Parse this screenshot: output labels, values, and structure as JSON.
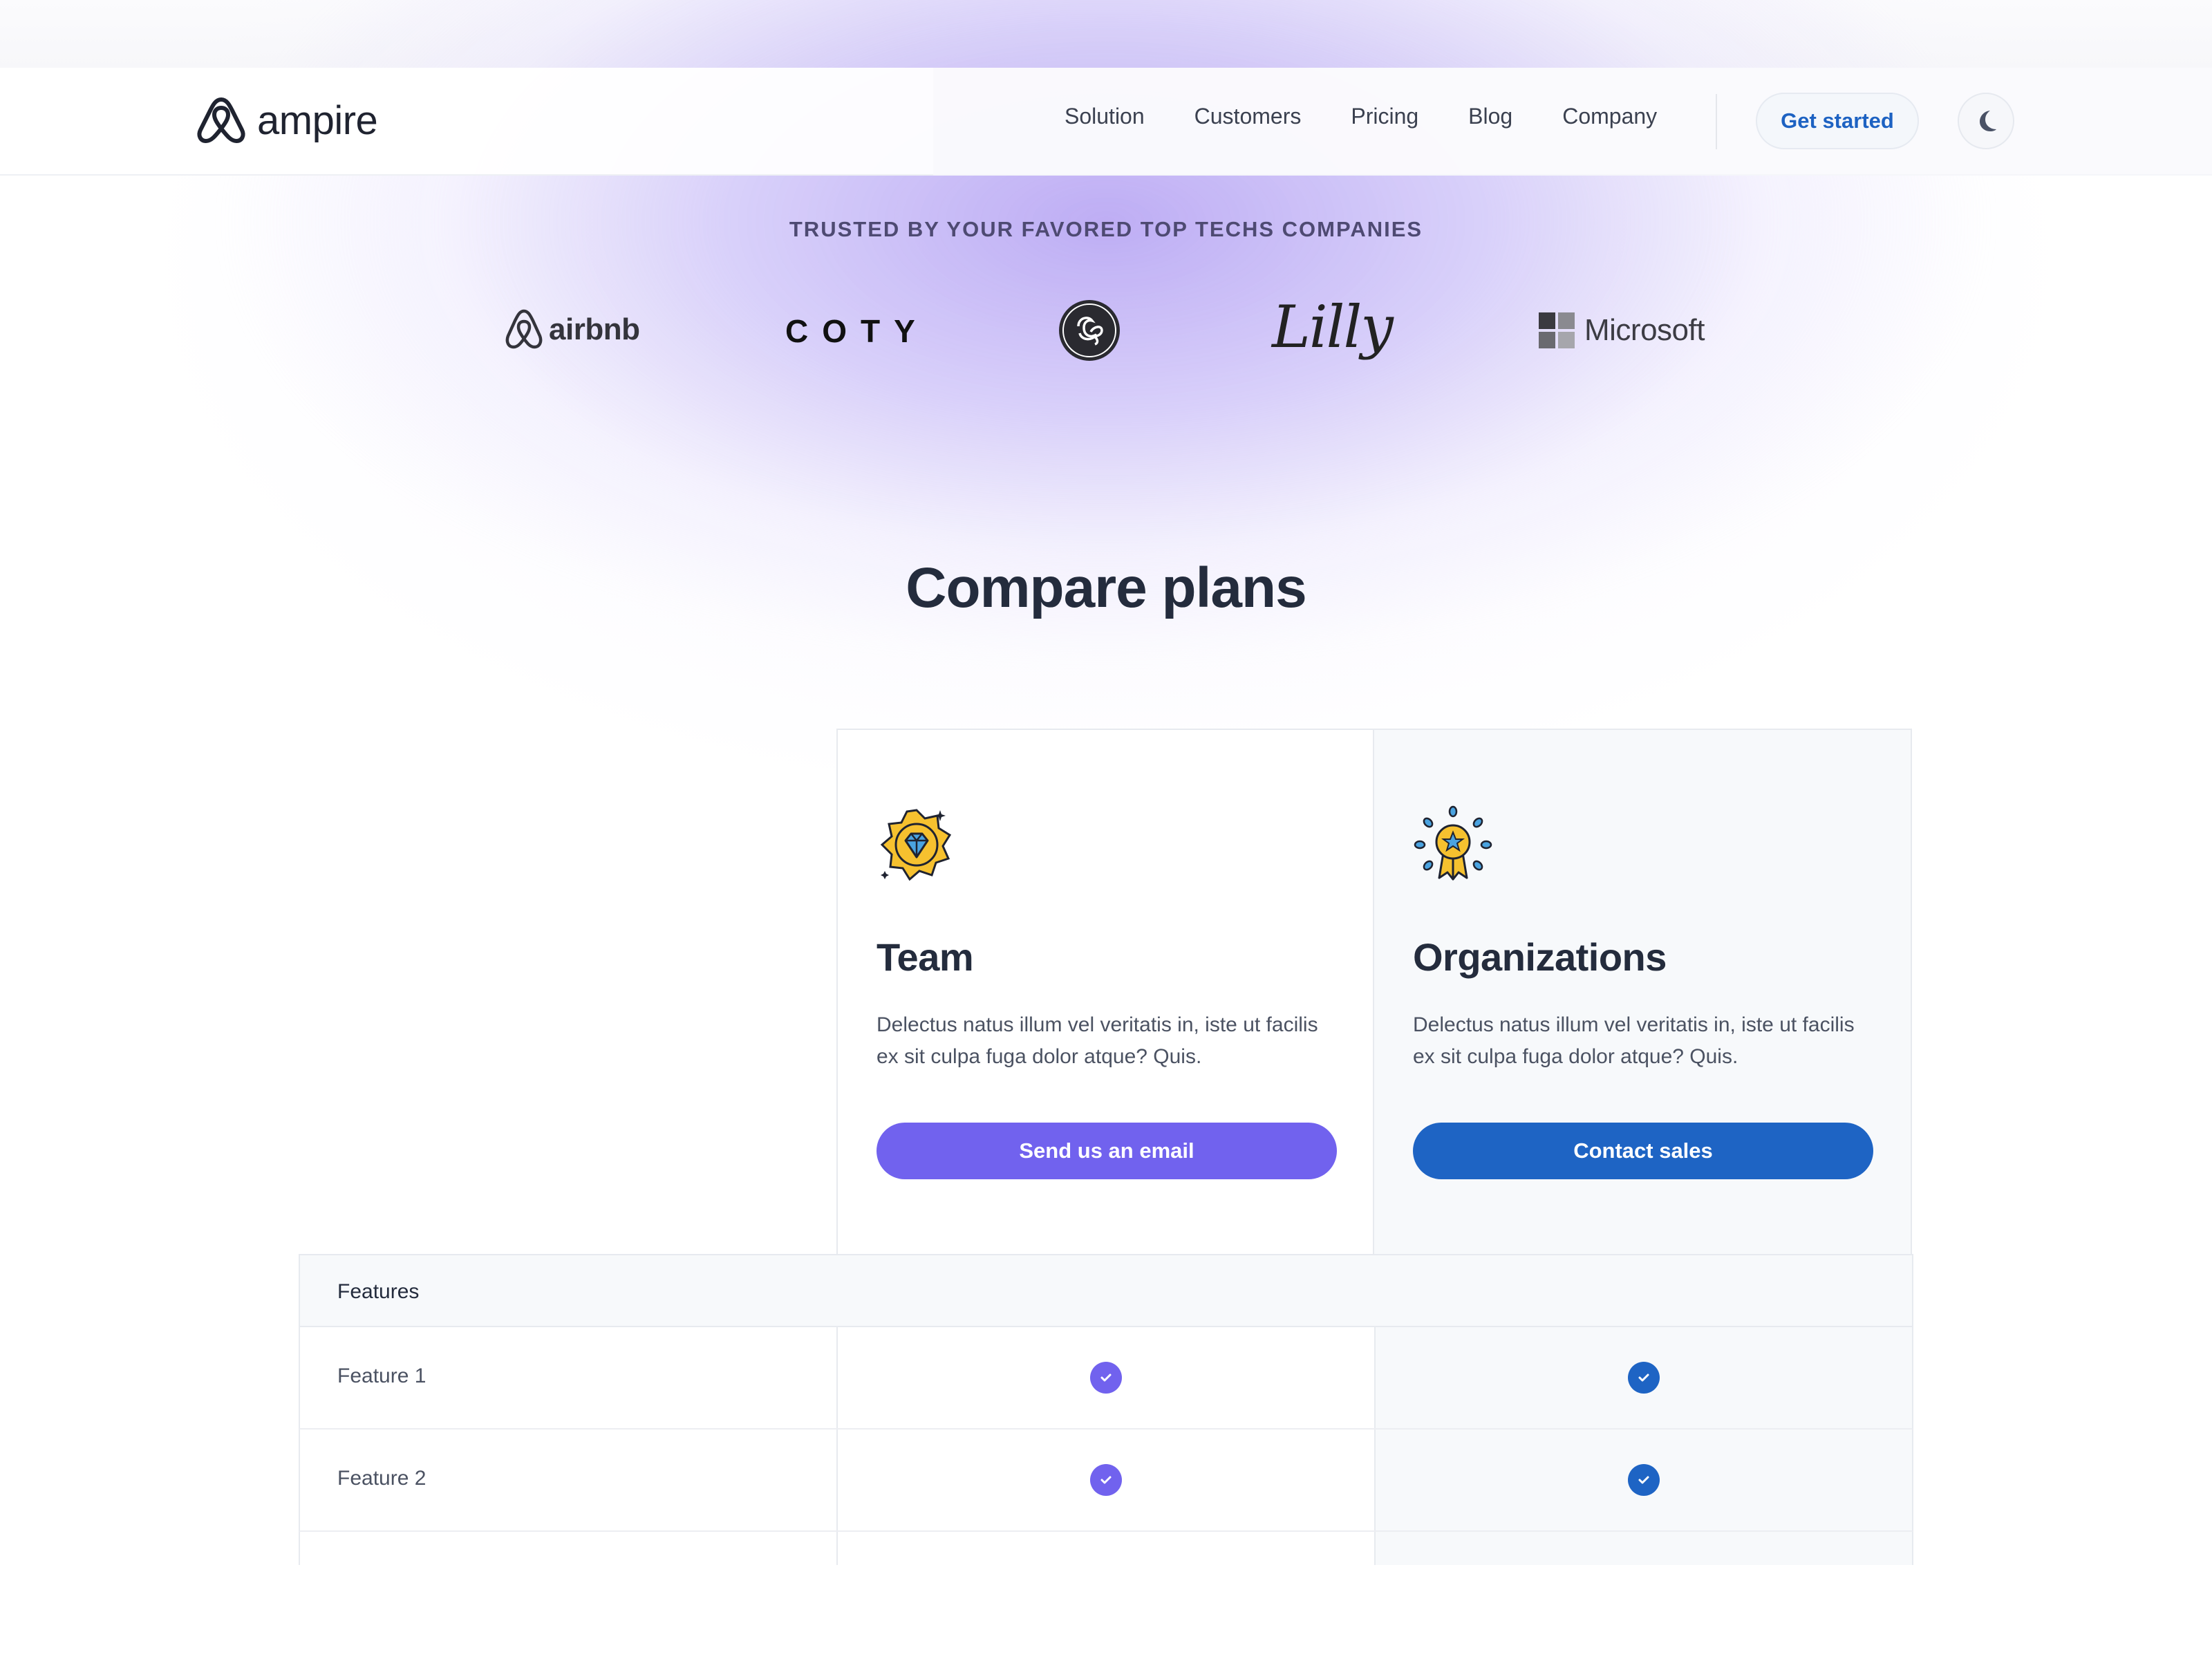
{
  "brand": {
    "name": "ampire",
    "icon": "ampire-logo-icon"
  },
  "nav": {
    "links": [
      "Solution",
      "Customers",
      "Pricing",
      "Blog",
      "Company"
    ],
    "cta": "Get started",
    "theme_toggle_icon": "moon-icon"
  },
  "trusted": {
    "title": "TRUSTED BY YOUR FAVORED TOP TECHS COMPANIES",
    "logos": {
      "airbnb": "airbnb",
      "coty": "COTY",
      "ge": "GE",
      "lilly": "Lilly",
      "microsoft": "Microsoft"
    }
  },
  "compare": {
    "title": "Compare plans",
    "plans": [
      {
        "name": "Team",
        "icon": "diamond-badge-icon",
        "description": "Delectus natus illum vel veritatis in, iste ut facilis ex sit culpa fuga dolor atque? Quis.",
        "button": "Send us an email",
        "color": "#7162ee"
      },
      {
        "name": "Organizations",
        "icon": "award-medal-icon",
        "description": "Delectus natus illum vel veritatis in, iste ut facilis ex sit culpa fuga dolor atque? Quis.",
        "button": "Contact sales",
        "color": "#1e64c4"
      }
    ]
  },
  "features": {
    "header": "Features",
    "rows": [
      {
        "label": "Feature 1",
        "team": true,
        "organizations": true
      },
      {
        "label": "Feature 2",
        "team": true,
        "organizations": true
      }
    ]
  },
  "colors": {
    "accent_violet": "#7162ee",
    "accent_blue": "#1e64c4",
    "title_text": "#242c3d",
    "glow": "#b7a7f3"
  }
}
